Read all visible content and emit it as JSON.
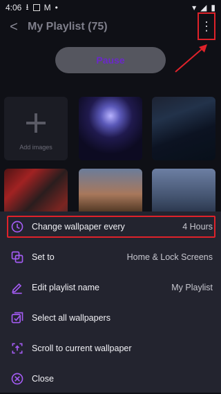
{
  "status_bar": {
    "time": "4:06"
  },
  "header": {
    "title": "My Playlist  (75)"
  },
  "controls": {
    "pause_label": "Pause"
  },
  "gallery": {
    "add_images_label": "Add images"
  },
  "menu": {
    "items": [
      {
        "label": "Change wallpaper every",
        "value": "4 Hours"
      },
      {
        "label": "Set to",
        "value": "Home & Lock Screens"
      },
      {
        "label": "Edit playlist name",
        "value": "My Playlist"
      },
      {
        "label": "Select all wallpapers",
        "value": ""
      },
      {
        "label": "Scroll to current wallpaper",
        "value": ""
      },
      {
        "label": "Close",
        "value": ""
      }
    ]
  },
  "colors": {
    "accent": "#a35bf2",
    "highlight": "#e0222a",
    "sheet_bg": "#23242f",
    "app_bg": "#0f1016"
  }
}
